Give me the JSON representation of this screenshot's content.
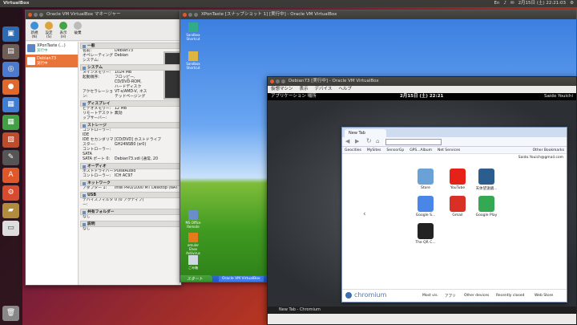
{
  "topbar": {
    "title": "VirtualBox",
    "clock": "2月15日 (土) 22:21:03",
    "ind1": "En",
    "ind2": "♪",
    "ind3": "✉",
    "ind4": "⚙"
  },
  "manager": {
    "title": "Oracle VM VirtualBox マネージャー",
    "toolbar": [
      {
        "label": "新規(N)",
        "color": "#3f8fd9"
      },
      {
        "label": "設定(S)",
        "color": "#e0a23a"
      },
      {
        "label": "表示(H)",
        "color": "#46a446"
      },
      {
        "label": "破棄",
        "color": "#bbbbbb"
      }
    ],
    "vms": [
      {
        "name": "XPonTaste (...)",
        "state": "実行中"
      },
      {
        "name": "Debian73",
        "state": "実行中"
      }
    ],
    "sections": [
      {
        "title": "一般",
        "rows": [
          [
            "名前:",
            "Debian73"
          ],
          [
            "オペレーティングシステム:",
            "Debian"
          ]
        ]
      },
      {
        "title": "システム",
        "rows": [
          [
            "メインメモリー:",
            "1024 MB"
          ],
          [
            "起動順序:",
            "フロッピー,\nCD/DVD-ROM,\nハードディスク"
          ],
          [
            "アクセラレーション:",
            "VT-x/AMD-V, ネス\nテッドページング"
          ]
        ]
      },
      {
        "title": "ディスプレイ",
        "rows": [
          [
            "ビデオメモリー:",
            "12 MB"
          ],
          [
            "リモートデスクトップサーバー:",
            "無効"
          ]
        ]
      },
      {
        "title": "ストレージ",
        "rows": [
          [
            "コントローラー: IDE",
            ""
          ],
          [
            "IDE セカンダリマスター:",
            "[CD/DVD] ホストドライブ\nGH24NSB0 (sr0)"
          ],
          [
            "コントローラー: SATA",
            ""
          ],
          [
            "SATA ポート 0:",
            "Debian73.vdi (通常, 20"
          ]
        ]
      },
      {
        "title": "オーディオ",
        "rows": [
          [
            "ホストドライバー:",
            "PulseAudio"
          ],
          [
            "コントローラー:",
            "ICH AC97"
          ]
        ]
      },
      {
        "title": "ネットワーク",
        "rows": [
          [
            "アダプター 1:",
            "Intel PRO/1000 MT Desktop (NAT"
          ]
        ]
      },
      {
        "title": "USB",
        "rows": [
          [
            "デバイスフィルター:",
            "0 (0 アクティブ)"
          ]
        ]
      },
      {
        "title": "共有フォルダー",
        "rows": [
          [
            "なし",
            ""
          ]
        ]
      },
      {
        "title": "説明",
        "rows": [
          [
            "なし",
            ""
          ]
        ]
      }
    ]
  },
  "xp": {
    "title": "XPonTaste [スナップショット 1] [実行中] - Oracle VM VirtualBox",
    "icons": [
      {
        "label": "Sandbox Shortcut"
      },
      {
        "label": "Sandbox Shortcut"
      },
      {
        "label": "MS Office Remote"
      },
      {
        "label": "emuler Ehee Antivirus"
      },
      {
        "label": "ごみ箱"
      }
    ],
    "start": "スタート",
    "task": "Oracle VM VirtualBox"
  },
  "debian": {
    "title": "Debian73 [実行中] - Oracle VM VirtualBox",
    "menu": [
      "仮想マシン",
      "表示",
      "デバイス",
      "ヘルプ"
    ],
    "gnome": {
      "apps": "アプリケーション  場所",
      "clock": "2月15日 (土) 22:21",
      "user": "Saido Youichi"
    },
    "task": "New Tab - Chromium",
    "chrome": {
      "tab": "New Tab",
      "bookmarks": [
        "Geocities",
        "MySites",
        "SensorGp",
        "GPS...Album",
        "Net Services",
        "Other Bookmarks"
      ],
      "signin": "Saido.Youich@gmail.com",
      "apps": [
        {
          "label": "Store",
          "color": "#6aa2d8"
        },
        {
          "label": "YouTube",
          "color": "#e62117"
        },
        {
          "label": "天体望遠鏡...",
          "color": "#2b5e8e"
        },
        {
          "label": "Google S...",
          "color": "#4a86e8"
        },
        {
          "label": "Gmail",
          "color": "#d93025"
        },
        {
          "label": "Google Play",
          "color": "#35a853"
        },
        {
          "label": "The QR C...",
          "color": "#222222"
        }
      ],
      "brand": "chromium",
      "foot": [
        "Most vis.",
        "アプリ",
        "Other devices",
        "Recently closed",
        "Web Store"
      ]
    }
  }
}
